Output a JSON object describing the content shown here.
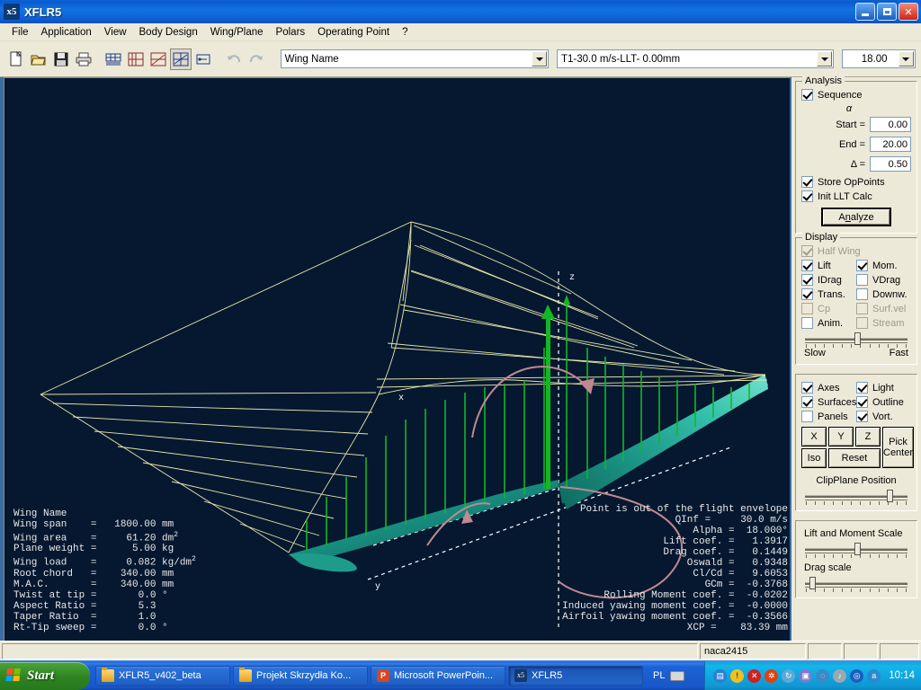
{
  "window": {
    "title": "XFLR5",
    "icon": "xflr5-app-icon",
    "minimize_label": "Minimize",
    "maximize_label": "Restore",
    "close_label": "Close"
  },
  "menubar": {
    "items": [
      {
        "label": "File"
      },
      {
        "label": "Application"
      },
      {
        "label": "View"
      },
      {
        "label": "Body Design"
      },
      {
        "label": "Wing/Plane"
      },
      {
        "label": "Polars"
      },
      {
        "label": "Operating Point"
      },
      {
        "label": "?"
      }
    ]
  },
  "toolbar": {
    "buttons": [
      {
        "name": "new-project-icon",
        "title": "New"
      },
      {
        "name": "open-project-icon",
        "title": "Open"
      },
      {
        "name": "save-project-icon",
        "title": "Save"
      },
      {
        "name": "print-icon",
        "title": "Print"
      },
      {
        "name": "wing-design-view-icon",
        "title": "Wing Design"
      },
      {
        "name": "polar-graph-view-icon",
        "title": "Polar Graphs"
      },
      {
        "name": "opoint-graph-view-icon",
        "title": "Operating Point"
      },
      {
        "name": "three-d-view-icon",
        "title": "3D View"
      },
      {
        "name": "cp-view-icon",
        "title": "Cp View"
      },
      {
        "name": "undo-icon",
        "title": "Undo"
      },
      {
        "name": "redo-icon",
        "title": "Redo"
      }
    ],
    "wing_name": "Wing Name",
    "polar_name": "T1-30.0 m/s-LLT-  0.00mm",
    "alpha_value": "18.00"
  },
  "view3d": {
    "background_color": "#051830",
    "lift_line_color": "#e6e6a8",
    "lift_vector_color": "#12b824",
    "moment_arc_color": "#c08890",
    "surface_color": "#1f9d8c",
    "axis_color": "#ffffff",
    "axis_labels": {
      "z": "z",
      "y": "y",
      "x": "x"
    }
  },
  "wing_geometry": {
    "title": "Wing Name",
    "rows": [
      {
        "label": "Wing span",
        "value": "1800.00",
        "unit": "mm",
        "sup": ""
      },
      {
        "label": "Wing area",
        "value": "61.20",
        "unit": "dm",
        "sup": "2"
      },
      {
        "label": "Plane weight",
        "value": "5.00",
        "unit": "kg",
        "sup": ""
      },
      {
        "label": "Wing load",
        "value": "0.082",
        "unit": "kg/dm",
        "sup": "2"
      },
      {
        "label": "Root chord",
        "value": "340.00",
        "unit": "mm",
        "sup": ""
      },
      {
        "label": "M.A.C.",
        "value": "340.00",
        "unit": "mm",
        "sup": ""
      },
      {
        "label": "Twist at tip",
        "value": "0.0",
        "unit": "°",
        "sup": ""
      },
      {
        "label": "Aspect Ratio",
        "value": "5.3",
        "unit": "",
        "sup": ""
      },
      {
        "label": "Taper Ratio",
        "value": "1.0",
        "unit": "",
        "sup": ""
      },
      {
        "label": "Rt-Tip sweep",
        "value": "0.0",
        "unit": "°",
        "sup": ""
      }
    ]
  },
  "results": {
    "warning": "Point is out of the flight envelope",
    "rows": [
      {
        "label": "QInf",
        "value": "30.0",
        "unit": "m/s"
      },
      {
        "label": "Alpha",
        "value": "18.000°",
        "unit": ""
      },
      {
        "label": "Lift coef.",
        "value": "1.3917",
        "unit": ""
      },
      {
        "label": "Drag coef.",
        "value": "0.1449",
        "unit": ""
      },
      {
        "label": "Oswald",
        "value": "0.9348",
        "unit": ""
      },
      {
        "label": "Cl/Cd",
        "value": "9.6053",
        "unit": ""
      },
      {
        "label": "GCm",
        "value": "-0.3768",
        "unit": ""
      },
      {
        "label": "Rolling Moment coef.",
        "value": "-0.0202",
        "unit": ""
      },
      {
        "label": "Induced yawing moment coef.",
        "value": "-0.0000",
        "unit": ""
      },
      {
        "label": "Airfoil yawing moment coef.",
        "value": "-0.3566",
        "unit": ""
      },
      {
        "label": "XCP",
        "value": "83.39",
        "unit": "mm"
      }
    ]
  },
  "analysis": {
    "group_label": "Analysis",
    "sequence_label": "Sequence",
    "sequence_checked": true,
    "alpha_symbol": "α",
    "start_label": "Start =",
    "start_value": "0.00",
    "end_label": "End =",
    "end_value": "20.00",
    "delta_label": "Δ =",
    "delta_value": "0.50",
    "store_oppoints_label": "Store OpPoints",
    "store_oppoints_checked": true,
    "init_llt_label": "Init LLT Calc",
    "init_llt_checked": true,
    "analyze_label_pre": "A",
    "analyze_label_key": "n",
    "analyze_label_post": "alyze"
  },
  "display": {
    "group_label": "Display",
    "options": [
      {
        "label": "Half Wing",
        "checked": true,
        "enabled": false,
        "col": "full"
      },
      {
        "label": "Lift",
        "checked": true,
        "enabled": true,
        "col": "left"
      },
      {
        "label": "Mom.",
        "checked": true,
        "enabled": true,
        "col": "right"
      },
      {
        "label": "IDrag",
        "checked": true,
        "enabled": true,
        "col": "left"
      },
      {
        "label": "VDrag",
        "checked": false,
        "enabled": true,
        "col": "right"
      },
      {
        "label": "Trans.",
        "checked": true,
        "enabled": true,
        "col": "left"
      },
      {
        "label": "Downw.",
        "checked": false,
        "enabled": true,
        "col": "right"
      },
      {
        "label": "Cp",
        "checked": false,
        "enabled": false,
        "col": "left"
      },
      {
        "label": "Surf.vel",
        "checked": false,
        "enabled": false,
        "col": "right"
      },
      {
        "label": "Anim.",
        "checked": false,
        "enabled": true,
        "col": "left"
      },
      {
        "label": "Stream",
        "checked": false,
        "enabled": false,
        "col": "right"
      }
    ],
    "speed_slow_label": "Slow",
    "speed_fast_label": "Fast",
    "speed_percent": 50
  },
  "viewopts": {
    "options": [
      {
        "label": "Axes",
        "checked": true
      },
      {
        "label": "Light",
        "checked": true
      },
      {
        "label": "Surfaces",
        "checked": true
      },
      {
        "label": "Outline",
        "checked": true
      },
      {
        "label": "Panels",
        "checked": false
      },
      {
        "label": "Vort.",
        "checked": true
      }
    ],
    "btn_x": "X",
    "btn_y": "Y",
    "btn_z": "Z",
    "btn_iso": "Iso",
    "btn_reset": "Reset",
    "btn_pick_line1": "Pick",
    "btn_pick_line2": "Center",
    "clipplane_label": "ClipPlane Position",
    "clipplane_percent": 82
  },
  "scales": {
    "lift_moment_label": "Lift and Moment Scale",
    "lift_moment_percent": 50,
    "drag_label": "Drag scale",
    "drag_percent": 7
  },
  "statusbar": {
    "main": "",
    "airfoil": "naca2415",
    "pane2": "",
    "pane3": "",
    "pane4": ""
  },
  "taskbar": {
    "start_label": "Start",
    "items": [
      {
        "label": "XFLR5_v402_beta",
        "icon": "folder-icon",
        "active": false
      },
      {
        "label": "Projekt Skrzydła Ko...",
        "icon": "folder-icon",
        "active": false
      },
      {
        "label": "Microsoft PowerPoin...",
        "icon": "powerpoint-icon",
        "active": false
      },
      {
        "label": "XFLR5",
        "icon": "xflr5-app-icon",
        "active": true
      }
    ],
    "language": "PL",
    "keyboard_icon": "keyboard-icon",
    "tray_icons": [
      {
        "name": "network-icon",
        "color": "#2a7fd4",
        "glyph": "◩"
      },
      {
        "name": "warning-icon",
        "color": "#f0c020",
        "glyph": "!"
      },
      {
        "name": "security-icon",
        "color": "#cc2222",
        "glyph": "✕"
      },
      {
        "name": "antivirus-icon",
        "color": "#e04010",
        "glyph": "✸"
      },
      {
        "name": "sync-icon",
        "color": "#5fa8d8",
        "glyph": "↻"
      },
      {
        "name": "display-icon",
        "color": "#7a7ad0",
        "glyph": "▣"
      },
      {
        "name": "update-icon",
        "color": "#3a8ac8",
        "glyph": "◌"
      },
      {
        "name": "volume-icon",
        "color": "#9aa8b0",
        "glyph": "♪"
      },
      {
        "name": "wireless-icon",
        "color": "#1a5fc0",
        "glyph": "◎"
      },
      {
        "name": "messenger-icon",
        "color": "#2a8ad0",
        "glyph": "a"
      }
    ],
    "clock": "10:14"
  }
}
